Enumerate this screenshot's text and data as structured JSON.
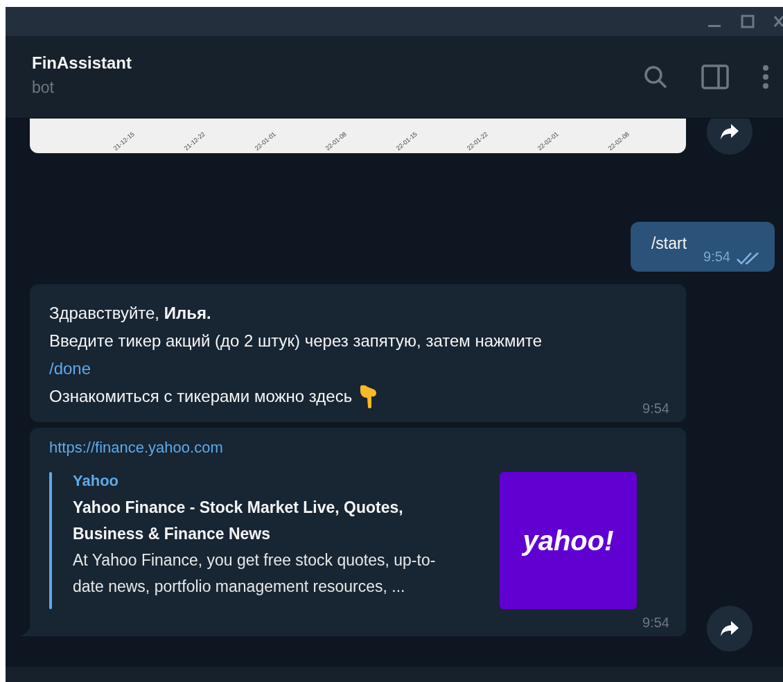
{
  "header": {
    "title": "FinAssistant",
    "subtitle": "bot"
  },
  "messages": [
    {
      "kind": "chart",
      "axis_labels": [
        "21-12-15",
        "21-12-22",
        "22-01-01",
        "22-01-08",
        "22-01-15",
        "22-01-22",
        "22-02-01",
        "22-02-08"
      ],
      "forward": true
    },
    {
      "kind": "outgoing",
      "text": "/start",
      "time": "9:54",
      "read": true
    },
    {
      "kind": "incoming",
      "lines": [
        {
          "text": "Здравствуйте, **Илья.**"
        },
        {
          "text": "Введите тикер акций (до 2  штук) через запятую, затем нажмите",
          "link": "/done"
        },
        {
          "text": "Ознакомиться с тикерами можно здесь",
          "emoji": true
        }
      ],
      "time": "9:54"
    },
    {
      "kind": "link",
      "url": "https://finance.yahoo.com",
      "site": "Yahoo",
      "title": "Yahoo Finance - Stock Market Live, Quotes, Business & Finance News",
      "description": "At Yahoo Finance, you get free stock quotes, up-to-date news, portfolio management resources, ...",
      "logo_text": "yahoo!",
      "time": "9:54",
      "forward": true
    }
  ]
}
